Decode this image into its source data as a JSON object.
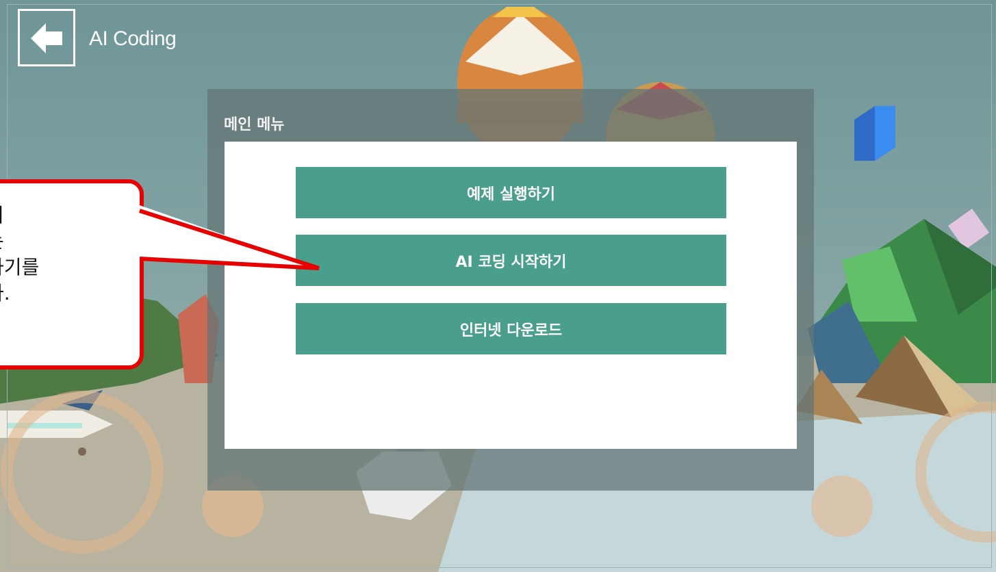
{
  "header": {
    "title": "AI Coding",
    "back_icon": "arrow-left-icon"
  },
  "menu": {
    "title": "메인 메뉴",
    "buttons": [
      {
        "label": "예제 실행하기"
      },
      {
        "label": "AI 코딩 시작하기"
      },
      {
        "label": "인터넷 다운로드"
      }
    ]
  },
  "callout": {
    "lines": [
      "기",
      "는",
      "하기를",
      "다."
    ]
  },
  "colors": {
    "button": "#499e8c",
    "callout_border": "#e60000"
  }
}
